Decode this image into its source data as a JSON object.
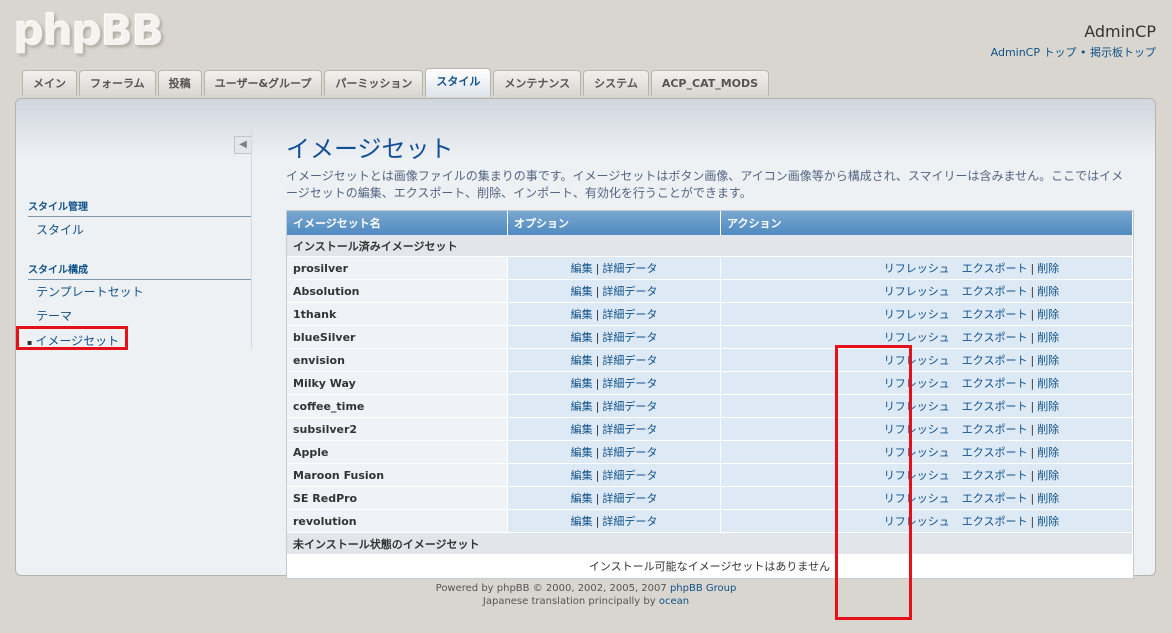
{
  "logo": "phpBB",
  "header": {
    "title": "AdminCP",
    "links": [
      "AdminCP トップ",
      "掲示板トップ"
    ],
    "link_sep": "•"
  },
  "tabs": [
    "メイン",
    "フォーラム",
    "投稿",
    "ユーザー&グループ",
    "パーミッション",
    "スタイル",
    "メンテナンス",
    "システム",
    "ACP_CAT_MODS"
  ],
  "active_tab": "スタイル",
  "sidebar": {
    "collapse_icon": "◀",
    "section1": "スタイル管理",
    "item_style": "スタイル",
    "section2": "スタイル構成",
    "item_template": "テンプレートセット",
    "item_theme": "テーマ",
    "item_imageset": "イメージセット"
  },
  "main": {
    "title": "イメージセット",
    "description": "イメージセットとは画像ファイルの集まりの事です。イメージセットはボタン画像、アイコン画像等から構成され、スマイリーは含みません。ここではイメージセットの編集、エクスポート、削除、インポート、有効化を行うことができます。"
  },
  "table": {
    "headers": [
      "イメージセット名",
      "オプション",
      "アクション"
    ],
    "installed_label": "インストール済みイメージセット",
    "uninstalled_label": "未インストール状態のイメージセット",
    "empty_message": "インストール可能なイメージセットはありません",
    "option_edit": "編集",
    "option_details": "詳細データ",
    "action_refresh": "リフレッシュ",
    "action_export": "エクスポート",
    "action_delete": "削除",
    "link_sep": "|",
    "rows": [
      "prosilver",
      "Absolution",
      "1thank",
      "blueSilver",
      "envision",
      "Milky Way",
      "coffee_time",
      "subsilver2",
      "Apple",
      "Maroon Fusion",
      "SE RedPro",
      "revolution"
    ]
  },
  "footer": {
    "line1_prefix": "Powered by phpBB © 2000, 2002, 2005, 2007",
    "line1_link": "phpBB Group",
    "line2_prefix": "Japanese translation principally by",
    "line2_link": "ocean"
  },
  "colors": {
    "accent": "#105289",
    "highlight": "#e5101a",
    "header_bar": "#4f8bc2"
  }
}
